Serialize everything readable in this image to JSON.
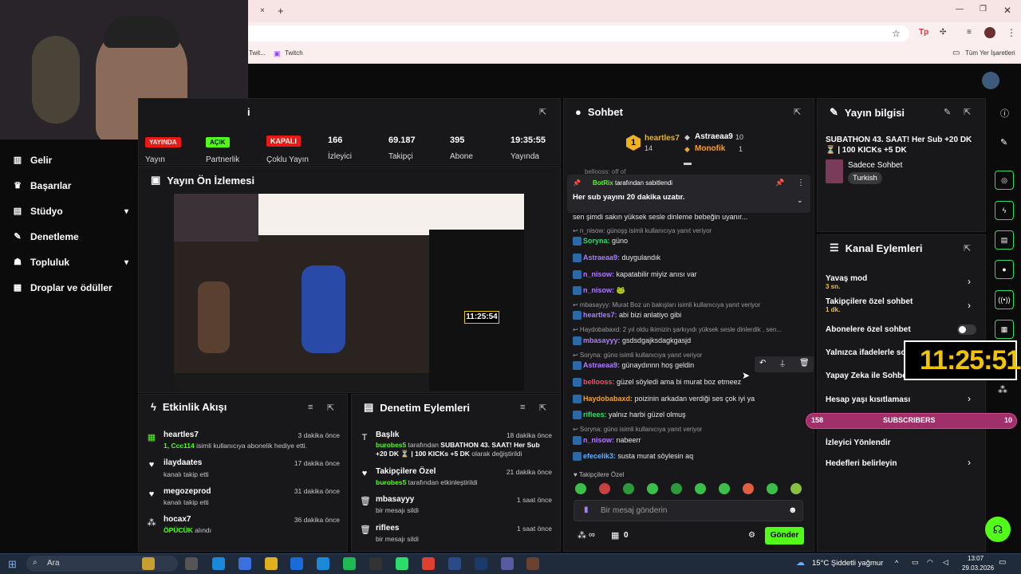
{
  "browser": {
    "tab_close": "×",
    "tab_new": "+",
    "bookmarks": {
      "item1": "Twit...",
      "item2": "Twitch",
      "all": "Tüm Yer İşaretleri"
    }
  },
  "nav": {
    "items": [
      {
        "label": "Gelir"
      },
      {
        "label": "Başarılar"
      },
      {
        "label": "Stüdyo"
      },
      {
        "label": "Denetleme"
      },
      {
        "label": "Topluluk"
      },
      {
        "label": "Droplar ve ödüller"
      }
    ]
  },
  "stats": {
    "title_partial": "i",
    "live_badge": "YAYINDA",
    "live_label": "Yayın",
    "partner_badge": "AÇIK",
    "partner_label": "Partnerlik",
    "multi_badge": "KAPALI",
    "multi_label": "Çoklu Yayın",
    "viewers_value": "166",
    "viewers_label": "İzleyici",
    "followers_value": "69.187",
    "followers_label": "Takipçi",
    "subs_value": "395",
    "subs_label": "Abone",
    "uptime_value": "19:35:55",
    "uptime_label": "Yayında"
  },
  "preview": {
    "title": "Yayın Ön İzlemesi",
    "timer": "11:25:54"
  },
  "activity": {
    "title": "Etkinlik Akışı",
    "events": [
      {
        "name": "heartles7",
        "time": "3 dakika önce",
        "desc_highlight": "1, Ccc114",
        "desc": "isimli kullanıcıya abonelik hediye etti."
      },
      {
        "name": "ilaydaates",
        "time": "17 dakika önce",
        "desc": "kanalı takip etti"
      },
      {
        "name": "megozeprod",
        "time": "31 dakika önce",
        "desc": "kanalı takip etti"
      },
      {
        "name": "hocax7",
        "time": "36 dakika önce",
        "desc_highlight": "ÖPÜCÜK",
        "desc": "alındı"
      }
    ]
  },
  "moderation": {
    "title": "Denetim Eylemleri",
    "actions": [
      {
        "name": "Başlık",
        "time": "18 dakika önce",
        "actor": "burobes5",
        "desc": "tarafından",
        "bold": "SUBATHON 43. SAAT! Her Sub +20 DK ⏳ | 100 KICKs +5 DK",
        "desc2": "olarak değiştirildi"
      },
      {
        "name": "Takipçilere Özel",
        "time": "21 dakika önce",
        "actor": "burobes5",
        "desc": "tarafından etkinleştirildi"
      },
      {
        "name": "mbasayyy",
        "time": "1 saat önce",
        "desc": "bir mesajı sildi"
      },
      {
        "name": "riflees",
        "time": "1 saat önce",
        "desc": "bir mesajı sildi"
      }
    ]
  },
  "chat": {
    "title": "Sohbet",
    "top": {
      "first_name": "heartles7",
      "first_count": "14",
      "rank": "1",
      "second_name": "Astraeaa9",
      "second_count": "10",
      "third_name": "Monofik",
      "third_count": "1"
    },
    "pinned": {
      "by": "BotRix",
      "by_suffix": "tarafından sabitlendi",
      "text": "Her sub yayını 20 dakika uzatır."
    },
    "partial_top": "bellooss: off of",
    "messages": [
      {
        "text": "sen şimdi sakın yüksek sesle dinleme bebeğin uyanır..."
      },
      {
        "reply": "n_nisow: günoşş isimli kullanıcıya yanıt veriyor",
        "user": "Soryna",
        "color": "#2bdc6a",
        "text": "güno"
      },
      {
        "user": "Astraeaa9",
        "color": "#b07cff",
        "text": "duygulandık"
      },
      {
        "user": "n_nisow",
        "color": "#b07cff",
        "text": "kapatabilir miyiz anısı var"
      },
      {
        "user": "n_nisow",
        "color": "#b07cff",
        "text": "🐸"
      },
      {
        "reply": "mbasayyy: Murat Boz un bakışları isimli kullanıcıya yanıt veriyor",
        "user": "heartles7",
        "color": "#b07cff",
        "text": "abi bizi anlatiyo gibi"
      },
      {
        "reply": "Haydobabaxd: 2 yıl oldu ikimizin şarkıyıdı yüksek sesle dinlerdik , sen...",
        "user": "mbasayyy",
        "color": "#b07cff",
        "text": "gsdsdgajksdagkgasjd"
      },
      {
        "reply": "Soryna: güno isimli kullanıcıya yanıt veriyor",
        "user": "Astraeaa9",
        "color": "#b07cff",
        "text": "günaydınnn hoş geldin"
      },
      {
        "user": "bellooss",
        "color": "#ff4a6a",
        "text": "güzel söyledi ama bi murat boz etmeez"
      },
      {
        "user": "Haydobabaxd",
        "color": "#f0a030",
        "text": "poizinin arkadan verdiği ses çok iyi ya"
      },
      {
        "user": "riflees",
        "color": "#2bdc6a",
        "text": "yalnız harbi güzel olmuş"
      },
      {
        "reply": "Soryna: güno isimli kullanıcıya yanıt veriyor",
        "user": "n_nisow",
        "color": "#b07cff",
        "text": "nabeerr"
      },
      {
        "user": "efecelik3",
        "color": "#5fb0ff",
        "text": "susta murat söylesin aq"
      }
    ],
    "followers_only": "Takipçilere Özel",
    "input_placeholder": "Bir mesaj gönderin",
    "points": "∞",
    "gifts": "0",
    "send": "Gönder"
  },
  "stream_info": {
    "title": "Yayın bilgisi",
    "stream_title": "SUBATHON 43. SAAT! Her Sub +20 DK ⏳ | 100 KICKs +5 DK",
    "category": "Sadece Sohbet",
    "tag": "Turkish"
  },
  "channel_actions": {
    "title": "Kanal Eylemleri",
    "items": [
      {
        "label": "Yavaş mod",
        "sub": "3 sn."
      },
      {
        "label": "Takipçilere özel sohbet",
        "sub": "1 dk."
      },
      {
        "label": "Abonelere özel sohbet"
      },
      {
        "label": "Yalnızca ifadelerle so"
      },
      {
        "label": "Yapay Zeka ile Sohbet"
      },
      {
        "label": "Hesap yaşı kısıtlaması"
      },
      {
        "label": "İzleyici Yönlendir"
      },
      {
        "label": "Hedefleri belirleyin"
      }
    ]
  },
  "overlay": {
    "clock": "11:25:51",
    "subs_left": "158",
    "subs_label": "SUBSCRIBERS",
    "subs_right": "10"
  },
  "taskbar": {
    "search": "Ara",
    "weather": "15°C  Şiddetli yağmur",
    "time": "13:07",
    "date": "29.03.2026"
  }
}
